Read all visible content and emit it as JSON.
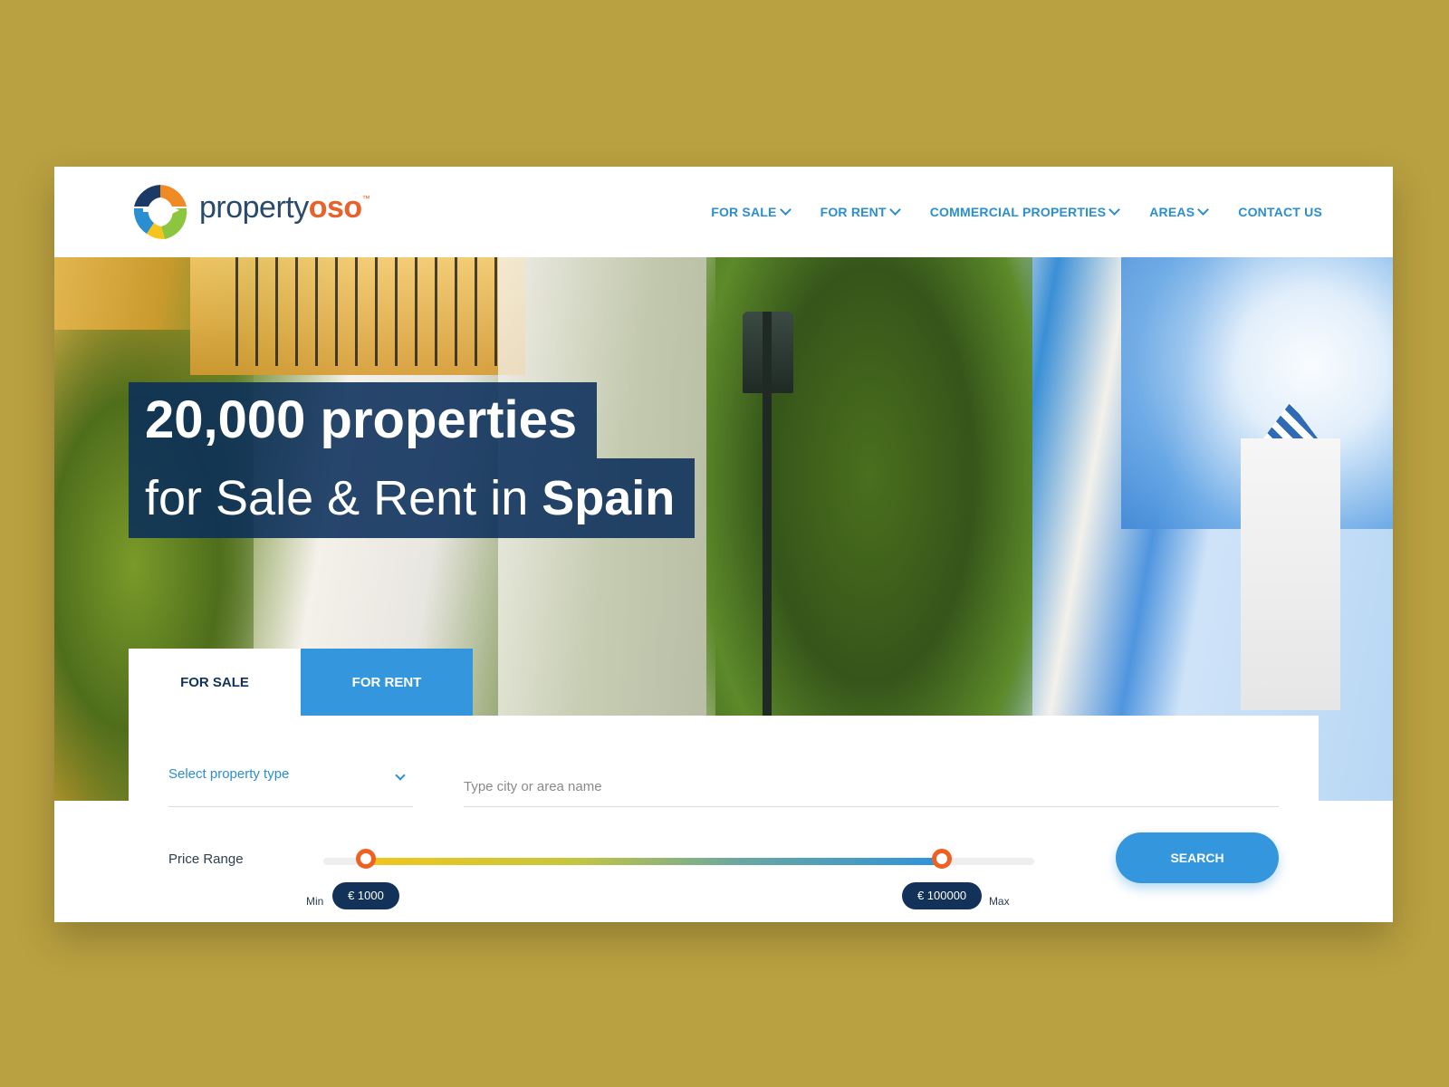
{
  "brand": {
    "name_prefix": "property",
    "name_suffix": "oso",
    "trademark": "™"
  },
  "nav": {
    "items": [
      {
        "label": "FOR SALE",
        "has_dropdown": true
      },
      {
        "label": "FOR RENT",
        "has_dropdown": true
      },
      {
        "label": "COMMERCIAL PROPERTIES",
        "has_dropdown": true
      },
      {
        "label": "AREAS",
        "has_dropdown": true
      },
      {
        "label": "CONTACT US",
        "has_dropdown": false
      }
    ]
  },
  "hero": {
    "line1": "20,000 properties",
    "line2_prefix": "for Sale & Rent in ",
    "line2_bold": "Spain"
  },
  "tabs": {
    "sale": "FOR SALE",
    "rent": "FOR RENT",
    "active": "sale"
  },
  "search": {
    "property_type_placeholder": "Select property type",
    "city_placeholder": "Type city or area name",
    "price_label": "Price Range",
    "min_label": "Min",
    "max_label": "Max",
    "min_value": "€ 1000",
    "max_value": "€ 100000",
    "min_fraction": 0.06,
    "max_fraction": 0.87,
    "button": "SEARCH"
  },
  "colors": {
    "accent_blue": "#2a8ed1",
    "navy": "#12325a",
    "orange": "#ef6122",
    "backdrop": "#b9a040"
  }
}
